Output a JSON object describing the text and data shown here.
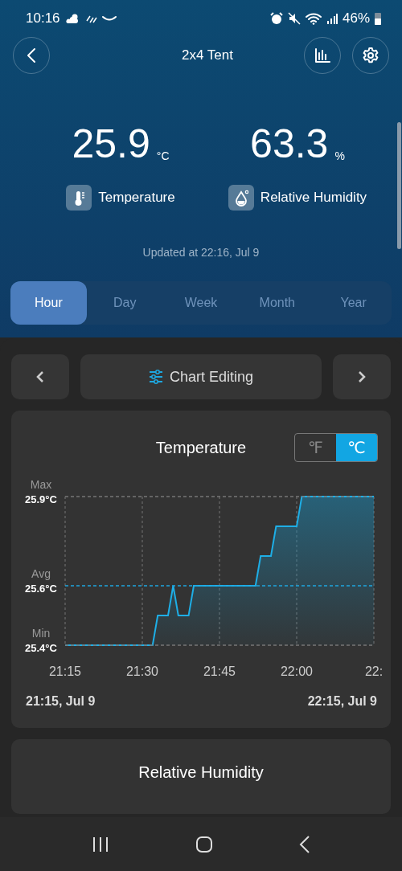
{
  "status_bar": {
    "time": "10:16",
    "battery": "46%"
  },
  "header": {
    "title": "2x4 Tent"
  },
  "readings": [
    {
      "kind": "temperature",
      "value": "25.9",
      "unit": "°C",
      "label": "Temperature"
    },
    {
      "kind": "humidity",
      "value": "63.3",
      "unit": "%",
      "label": "Relative Humidity"
    }
  ],
  "updated": "Updated at 22:16, Jul 9",
  "tabs": [
    {
      "label": "Hour",
      "selected": true
    },
    {
      "label": "Day",
      "selected": false
    },
    {
      "label": "Week",
      "selected": false
    },
    {
      "label": "Month",
      "selected": false
    },
    {
      "label": "Year",
      "selected": false
    }
  ],
  "chart_nav": {
    "label": "Chart Editing"
  },
  "temperature_card": {
    "title": "Temperature",
    "units": [
      {
        "label": "℉",
        "selected": false
      },
      {
        "label": "℃",
        "selected": true
      }
    ],
    "chart_data": {
      "type": "area",
      "categories": [
        "21:15",
        null,
        null,
        null,
        null,
        null,
        null,
        null,
        null,
        null,
        null,
        null,
        null,
        null,
        null,
        "21:30",
        null,
        null,
        null,
        null,
        null,
        null,
        null,
        null,
        null,
        null,
        null,
        null,
        null,
        null,
        "21:45",
        null,
        null,
        null,
        null,
        null,
        null,
        null,
        null,
        null,
        null,
        null,
        null,
        null,
        null,
        "22:00",
        null,
        null,
        null,
        null,
        null,
        null,
        null,
        null,
        null,
        null,
        null,
        null,
        null,
        null,
        null
      ],
      "series": [
        {
          "color": "#1eaee6",
          "values": [
            25.4,
            25.4,
            25.4,
            25.4,
            25.4,
            25.4,
            25.4,
            25.4,
            25.4,
            25.4,
            25.4,
            25.4,
            25.4,
            25.4,
            25.4,
            25.4,
            25.4,
            25.4,
            25.5,
            25.5,
            25.5,
            25.6,
            25.5,
            25.5,
            25.5,
            25.6,
            25.6,
            25.6,
            25.6,
            25.6,
            25.6,
            25.6,
            25.6,
            25.6,
            25.6,
            25.6,
            25.6,
            25.6,
            25.7,
            25.7,
            25.7,
            25.8,
            25.8,
            25.8,
            25.8,
            25.8,
            25.9,
            25.9,
            25.9,
            25.9,
            25.9,
            25.9,
            25.9,
            25.9,
            25.9,
            25.9,
            25.9,
            25.9,
            25.9,
            25.9,
            25.9
          ]
        }
      ],
      "ylim": [
        25.4,
        25.9
      ],
      "grid": true,
      "yticks": [
        {
          "value": 25.9,
          "label": "25.9°C"
        },
        {
          "value": 25.6,
          "label": "25.6°C"
        },
        {
          "value": 25.4,
          "label": "25.4°C"
        }
      ],
      "ref_lines": [
        {
          "axis": "y",
          "value": 25.9,
          "label": "Max",
          "color": "#777777"
        },
        {
          "axis": "y",
          "value": 25.6,
          "label": "Avg",
          "color": "#1ea7df"
        },
        {
          "axis": "y",
          "value": 25.4,
          "label": "Min",
          "color": "#777777"
        }
      ]
    },
    "last_tick_partial": "22:",
    "range_start": "21:15, Jul 9",
    "range_end": "22:15, Jul 9"
  },
  "humidity_card": {
    "title": "Relative Humidity"
  }
}
